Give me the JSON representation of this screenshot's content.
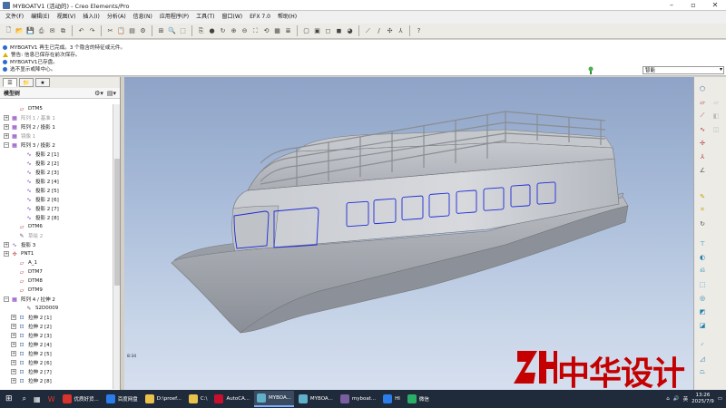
{
  "window": {
    "title": "MYBOATV1 (活动的) - Creo Elements/Pro"
  },
  "menubar": {
    "items": [
      "文件(F)",
      "编辑(E)",
      "视图(V)",
      "插入(I)",
      "分析(A)",
      "信息(N)",
      "应用程序(P)",
      "工具(T)",
      "窗口(W)",
      "EFX 7.0",
      "帮助(H)"
    ]
  },
  "messages": [
    {
      "kind": "info",
      "text": "MYBOATV1 再生已完成。3 个隐含的特征或元件。"
    },
    {
      "kind": "warn",
      "text": "警告: 信息已保存在前次保存。"
    },
    {
      "kind": "info",
      "text": "MYBOATV1已存盘。"
    },
    {
      "kind": "info",
      "text": "选不显示或降中心。"
    }
  ],
  "smart_filter": "智能",
  "model_tree": {
    "title": "模型树",
    "rows": [
      {
        "label": "DTM5",
        "icon": "datum",
        "exp": "",
        "indent": 1,
        "dim": false
      },
      {
        "label": "阵列 1 / 基准 1",
        "icon": "pattern",
        "exp": "+",
        "indent": 0,
        "dim": true
      },
      {
        "label": "阵列 2 / 投影 1",
        "icon": "pattern",
        "exp": "+",
        "indent": 0,
        "dim": false
      },
      {
        "label": "镜像 1",
        "icon": "pattern",
        "exp": "+",
        "indent": 0,
        "dim": true
      },
      {
        "label": "阵列 3 / 投影 2",
        "icon": "pattern",
        "exp": "−",
        "indent": 0,
        "dim": false
      },
      {
        "label": "投影 2 [1]",
        "icon": "proj",
        "exp": "",
        "indent": 2,
        "dim": false
      },
      {
        "label": "投影 2 [2]",
        "icon": "proj",
        "exp": "",
        "indent": 2,
        "dim": false
      },
      {
        "label": "投影 2 [3]",
        "icon": "proj",
        "exp": "",
        "indent": 2,
        "dim": false
      },
      {
        "label": "投影 2 [4]",
        "icon": "proj",
        "exp": "",
        "indent": 2,
        "dim": false
      },
      {
        "label": "投影 2 [5]",
        "icon": "proj",
        "exp": "",
        "indent": 2,
        "dim": false
      },
      {
        "label": "投影 2 [6]",
        "icon": "proj",
        "exp": "",
        "indent": 2,
        "dim": false
      },
      {
        "label": "投影 2 [7]",
        "icon": "proj",
        "exp": "",
        "indent": 2,
        "dim": false
      },
      {
        "label": "投影 2 [8]",
        "icon": "proj",
        "exp": "",
        "indent": 2,
        "dim": false
      },
      {
        "label": "DTM6",
        "icon": "datum",
        "exp": "",
        "indent": 1,
        "dim": false
      },
      {
        "label": "草绘 2",
        "icon": "sketch",
        "exp": "",
        "indent": 1,
        "dim": true
      },
      {
        "label": "投影 3",
        "icon": "proj",
        "exp": "+",
        "indent": 0,
        "dim": false
      },
      {
        "label": "PNT1",
        "icon": "pnt",
        "exp": "+",
        "indent": 0,
        "dim": false
      },
      {
        "label": "A_1",
        "icon": "datum",
        "exp": "",
        "indent": 1,
        "dim": false
      },
      {
        "label": "DTM7",
        "icon": "datum",
        "exp": "",
        "indent": 1,
        "dim": false
      },
      {
        "label": "DTM8",
        "icon": "datum",
        "exp": "",
        "indent": 1,
        "dim": false
      },
      {
        "label": "DTM9",
        "icon": "datum",
        "exp": "",
        "indent": 1,
        "dim": false
      },
      {
        "label": "阵列 4 / 拉伸 2",
        "icon": "pattern",
        "exp": "−",
        "indent": 0,
        "dim": false
      },
      {
        "label": "S2D0009",
        "icon": "sketch",
        "exp": "",
        "indent": 2,
        "dim": false
      },
      {
        "label": "拉伸 2 [1]",
        "icon": "extrude",
        "exp": "+",
        "indent": 1,
        "dim": false
      },
      {
        "label": "拉伸 2 [2]",
        "icon": "extrude",
        "exp": "+",
        "indent": 1,
        "dim": false
      },
      {
        "label": "拉伸 2 [3]",
        "icon": "extrude",
        "exp": "+",
        "indent": 1,
        "dim": false
      },
      {
        "label": "拉伸 2 [4]",
        "icon": "extrude",
        "exp": "+",
        "indent": 1,
        "dim": false
      },
      {
        "label": "拉伸 2 [5]",
        "icon": "extrude",
        "exp": "+",
        "indent": 1,
        "dim": false
      },
      {
        "label": "拉伸 2 [6]",
        "icon": "extrude",
        "exp": "+",
        "indent": 1,
        "dim": false
      },
      {
        "label": "拉伸 2 [7]",
        "icon": "extrude",
        "exp": "+",
        "indent": 1,
        "dim": false
      },
      {
        "label": "拉伸 2 [8]",
        "icon": "extrude",
        "exp": "+",
        "indent": 1,
        "dim": false
      }
    ]
  },
  "viewport": {
    "corner_label": "8:34"
  },
  "watermark": {
    "text": "中华设计",
    "color": "#c40000"
  },
  "taskbar": {
    "items": [
      {
        "label": "优质好货...",
        "color": "#d8342c",
        "active": false
      },
      {
        "label": "百度网盘",
        "color": "#2b7de9",
        "active": false
      },
      {
        "label": "D:\\proef...",
        "color": "#e8c24a",
        "active": false
      },
      {
        "label": "C:\\",
        "color": "#e8c24a",
        "active": false
      },
      {
        "label": "AutoCA...",
        "color": "#c8102e",
        "active": false
      },
      {
        "label": "MYBOA...",
        "color": "#5fb0c8",
        "active": true
      },
      {
        "label": "MYBOA...",
        "color": "#5fb0c8",
        "active": false
      },
      {
        "label": "myboat...",
        "color": "#7a5fa0",
        "active": false
      },
      {
        "label": "HI",
        "color": "#2b7de9",
        "active": false
      },
      {
        "label": "微信",
        "color": "#2aae67",
        "active": false
      }
    ],
    "ime": "英",
    "time": "13:26",
    "date": "2025/7/9"
  }
}
